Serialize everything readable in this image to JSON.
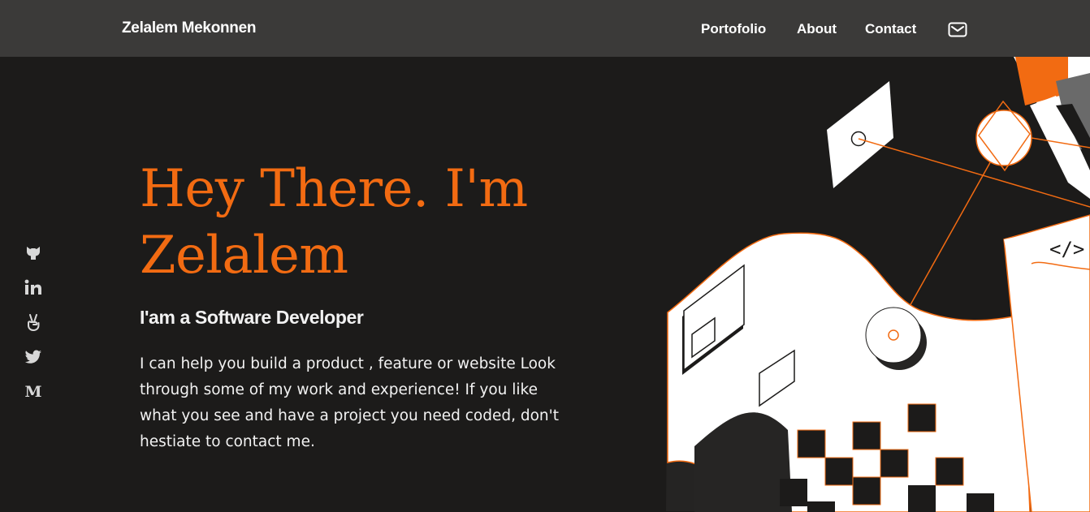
{
  "header": {
    "brand": "Zelalem Mekonnen",
    "nav": [
      {
        "label": "Portofolio"
      },
      {
        "label": "About"
      },
      {
        "label": "Contact"
      }
    ],
    "mail_icon": "mail-icon"
  },
  "social": [
    {
      "icon": "github-icon"
    },
    {
      "icon": "linkedin-icon"
    },
    {
      "icon": "angellist-icon"
    },
    {
      "icon": "twitter-icon"
    },
    {
      "icon": "medium-icon",
      "glyph": "M"
    }
  ],
  "hero": {
    "title_line1": "Hey There. I'm",
    "title_line2": "Zelalem",
    "subtitle": "I'am a Software Developer",
    "description": "I can help you build a product , feature or website Look through some of my work and experience! If you like what you see and have a project you need coded, don't hestiate to contact me."
  },
  "illustration": {
    "code_text": "</>",
    "icon": "developer-illustration"
  },
  "colors": {
    "accent": "#f26b12",
    "background": "#1c1b1a",
    "navbar": "#3b3a39",
    "text": "#f2f2f2"
  }
}
